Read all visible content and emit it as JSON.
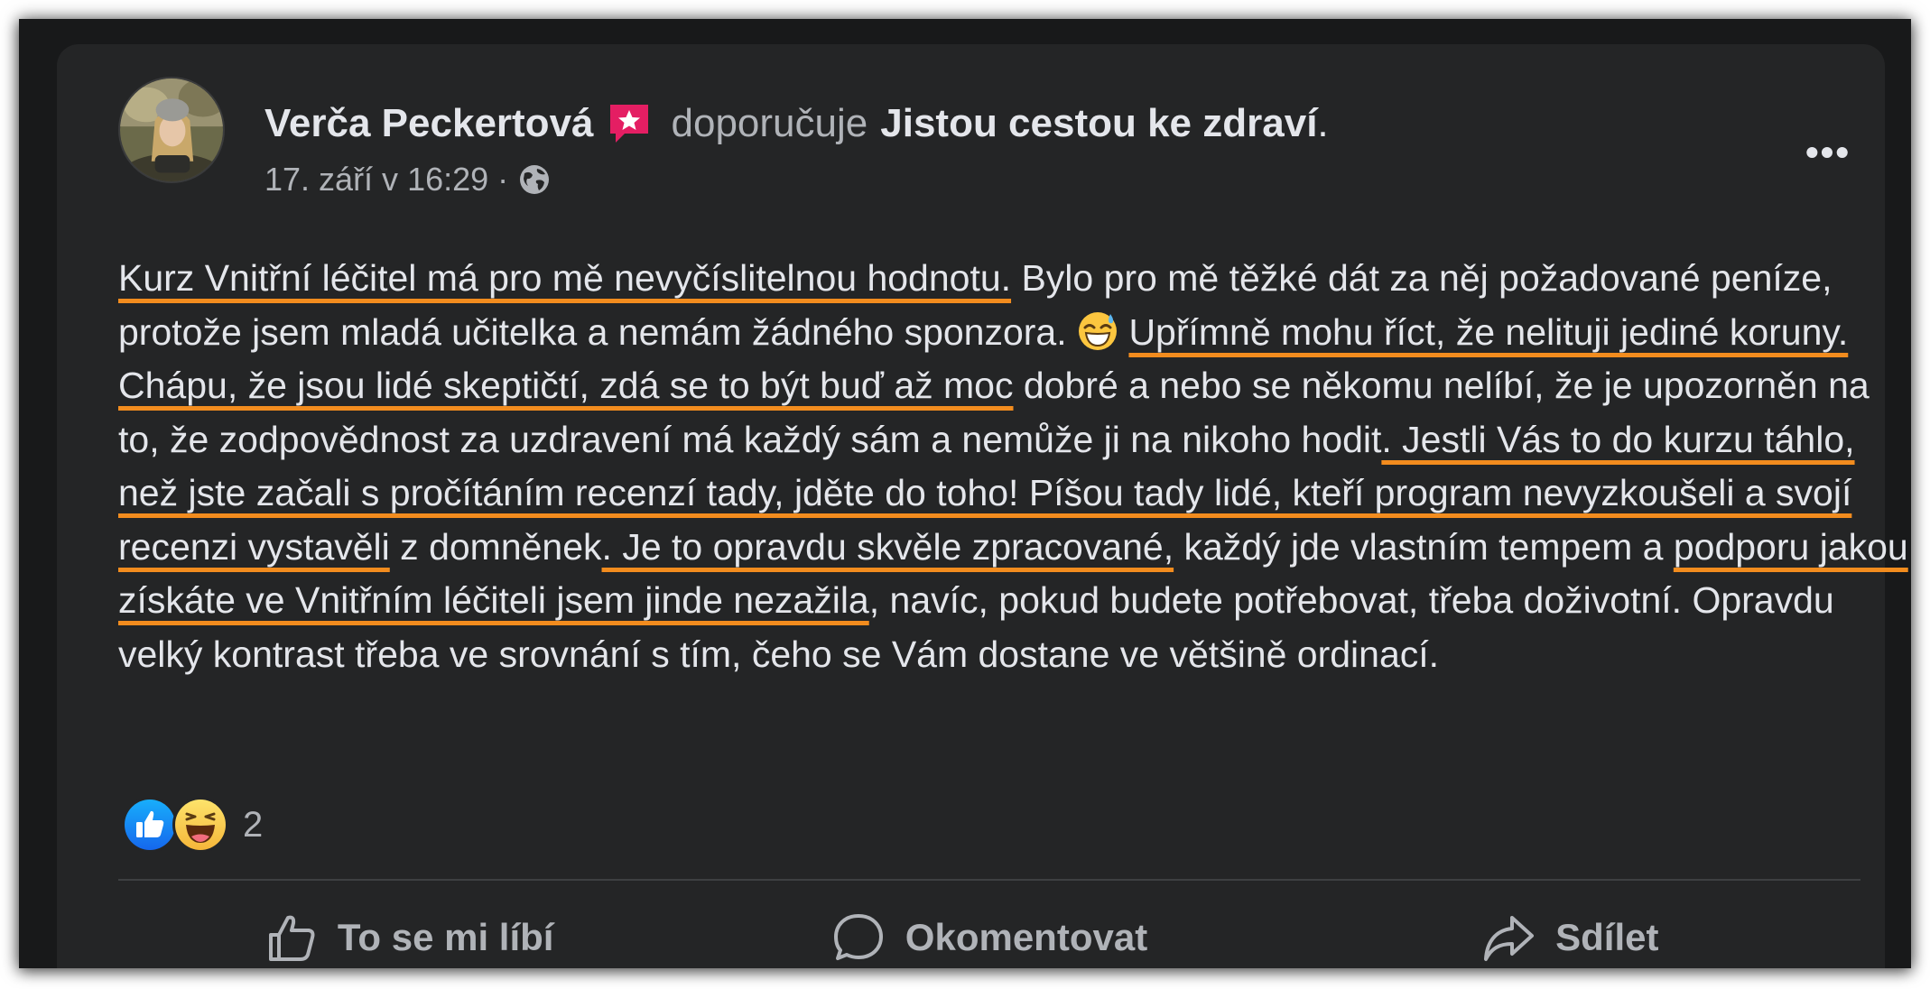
{
  "post": {
    "author": "Verča Peckertová",
    "recommends_text": "doporučuje",
    "page_name": "Jistou cestou ke zdraví",
    "period": ".",
    "timestamp": "17. září v 16:29 ·",
    "more_label": "•••",
    "segments": [
      {
        "text": "Kurz Vnitřní léčitel má pro mě nevyčíslitelnou hodnotu.",
        "hl": true
      },
      {
        "text": " Bylo pro mě těžké dát za něj požadované peníze, protože jsem mladá učitelka a nemám žádného sponzora. ",
        "hl": false
      },
      {
        "emoji": "grinning-sweat-emoji"
      },
      {
        "text": " ",
        "hl": false
      },
      {
        "text": "Upřímně mohu říct, že nelituji jediné koruny. Chápu, že jsou lidé skeptičtí, zdá se to být buď až moc",
        "hl": true
      },
      {
        "text": " dobré a nebo se někomu nelíbí, že je upozorněn na to, že zodpovědnost za uzdravení má každý sám a nemůže ji na nikoho hodit",
        "hl": false
      },
      {
        "text": ". Jestli Vás to do kurzu táhlo, než jste začali s pročítáním recenzí tady, jděte do toho! Píšou tady lidé, kteří program nevyzkoušeli a svojí recenzi vystavěli",
        "hl": true
      },
      {
        "text": " z domněnek",
        "hl": false
      },
      {
        "text": ". Je to opravdu skvěle zpracované,",
        "hl": true
      },
      {
        "text": " každý jde vlastním tempem a ",
        "hl": false
      },
      {
        "text": "podporu jakou získáte ve Vnitřním léčiteli jsem jinde nezažila",
        "hl": true
      },
      {
        "text": ", navíc, pokud budete potřebovat, třeba doživotní. Opravdu velký kontrast třeba ve srovnání s tím, čeho se Vám dostane ve většině ordinací.",
        "hl": false
      }
    ],
    "reactions": [
      "like-reaction-icon",
      "haha-reaction-icon"
    ],
    "reaction_count": "2"
  },
  "actions": {
    "like": "To se mi líbí",
    "comment": "Okomentovat",
    "share": "Sdílet"
  },
  "colors": {
    "highlight": "#f28c1e",
    "like_blue": "#1877f2",
    "badge_pink": "#e41e63"
  }
}
